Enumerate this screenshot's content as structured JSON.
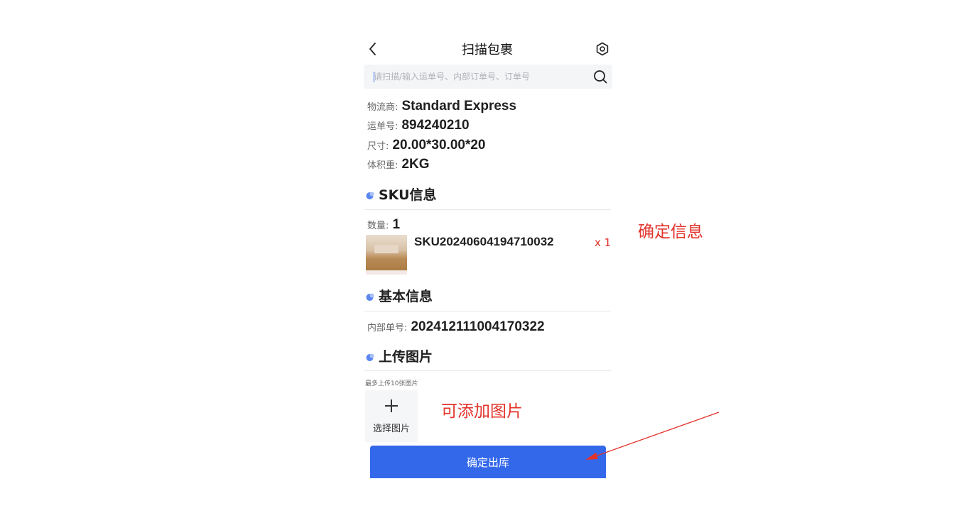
{
  "header": {
    "title": "扫描包裹",
    "back_icon": "chevron-left-icon",
    "settings_icon": "gear-icon"
  },
  "search": {
    "placeholder": "请扫描/输入运单号、内部订单号、订单号",
    "value": "",
    "icon": "search-icon"
  },
  "shipment": {
    "carrier_label": "物流商:",
    "carrier_value": "Standard Express",
    "waybill_label": "运单号:",
    "waybill_value": "894240210",
    "size_label": "尺寸:",
    "size_value": "20.00*30.00*20",
    "weight_label": "体积重:",
    "weight_value": "2KG"
  },
  "sku_section": {
    "title": "SKU信息",
    "count_label": "数量:",
    "count_value": "1",
    "items": [
      {
        "code": "SKU20240604194710032",
        "qty": "x 1"
      }
    ]
  },
  "basic_section": {
    "title": "基本信息",
    "order_label": "内部单号:",
    "order_value": "202412111004170322"
  },
  "upload_section": {
    "title": "上传图片",
    "hint": "最多上传10张图片",
    "button_label": "选择图片"
  },
  "confirm_button": "确定出库",
  "annotations": {
    "confirm_info": "确定信息",
    "add_images": "可添加图片"
  },
  "colors": {
    "accent": "#3468eb",
    "annotation": "#e2322a",
    "section_dot": "#5b86f0"
  }
}
